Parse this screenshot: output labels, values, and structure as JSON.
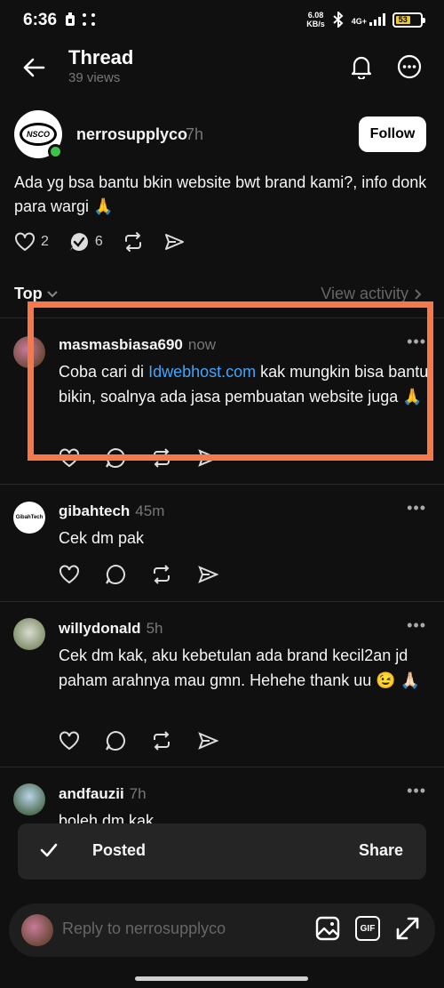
{
  "status": {
    "time": "6:36",
    "netspeed_value": "6.08",
    "netspeed_unit": "KB/s",
    "network": "4G+",
    "battery": "53"
  },
  "header": {
    "title": "Thread",
    "views": "39 views"
  },
  "post": {
    "username": "nerrosupplyco",
    "time": "7h",
    "avatar_logo_text": "NSCO",
    "follow_label": "Follow",
    "text": "Ada yg bsa bantu bkin website bwt brand kami?, info donk para wargi 🙏",
    "likes": "2",
    "replies": "6"
  },
  "sort": {
    "label": "Top",
    "view_activity": "View activity"
  },
  "replies": [
    {
      "username": "masmasbiasa690",
      "time": "now",
      "text_before": "Coba cari di ",
      "link": "Idwebhost.com",
      "text_after": " kak mungkin bisa bantu bikin, soalnya ada jasa pembuatan website juga 🙏"
    },
    {
      "username": "gibahtech",
      "time": "45m",
      "avatar_text": "GibahTech",
      "text": "Cek dm pak"
    },
    {
      "username": "willydonald",
      "time": "5h",
      "text": "Cek dm kak, aku kebetulan ada brand kecil2an jd paham arahnya mau gmn. Hehehe thank uu 😉 🙏🏻"
    },
    {
      "username": "andfauzii",
      "time": "7h",
      "text": "boleh dm kak"
    }
  ],
  "toast": {
    "label": "Posted",
    "share": "Share"
  },
  "composer": {
    "placeholder": "Reply to nerrosupplyco",
    "gif_label": "GIF"
  },
  "colors": {
    "accent_link": "#3ea6ff",
    "highlight": "#f5794a",
    "online": "#3cc447"
  }
}
